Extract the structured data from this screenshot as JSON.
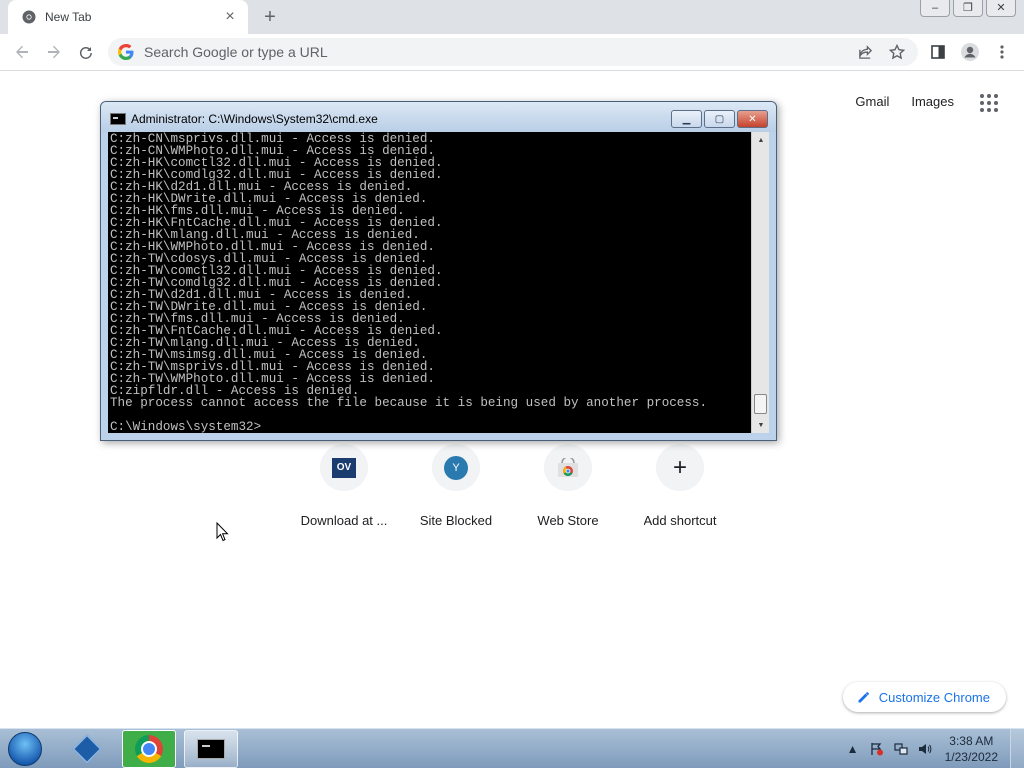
{
  "browser": {
    "tab": {
      "title": "New Tab"
    },
    "omnibox": {
      "placeholder": "Search Google or type a URL"
    }
  },
  "ntp": {
    "links": [
      {
        "label": "Gmail"
      },
      {
        "label": "Images"
      }
    ],
    "shortcuts": [
      {
        "label": "Download at ...",
        "icon": "ov-logo-icon",
        "icon_text": "OV"
      },
      {
        "label": "Site Blocked",
        "icon": "letter-y-icon",
        "icon_text": "Y"
      },
      {
        "label": "Web Store",
        "icon": "web-store-icon",
        "icon_text": ""
      },
      {
        "label": "Add shortcut",
        "icon": "plus-icon",
        "icon_text": "+"
      }
    ],
    "customize_label": "Customize Chrome"
  },
  "cmd": {
    "title": "Administrator: C:\\Windows\\System32\\cmd.exe",
    "lines": [
      "C:zh-CN\\msprivs.dll.mui - Access is denied.",
      "C:zh-CN\\WMPhoto.dll.mui - Access is denied.",
      "C:zh-HK\\comctl32.dll.mui - Access is denied.",
      "C:zh-HK\\comdlg32.dll.mui - Access is denied.",
      "C:zh-HK\\d2d1.dll.mui - Access is denied.",
      "C:zh-HK\\DWrite.dll.mui - Access is denied.",
      "C:zh-HK\\fms.dll.mui - Access is denied.",
      "C:zh-HK\\FntCache.dll.mui - Access is denied.",
      "C:zh-HK\\mlang.dll.mui - Access is denied.",
      "C:zh-HK\\WMPhoto.dll.mui - Access is denied.",
      "C:zh-TW\\cdosys.dll.mui - Access is denied.",
      "C:zh-TW\\comctl32.dll.mui - Access is denied.",
      "C:zh-TW\\comdlg32.dll.mui - Access is denied.",
      "C:zh-TW\\d2d1.dll.mui - Access is denied.",
      "C:zh-TW\\DWrite.dll.mui - Access is denied.",
      "C:zh-TW\\fms.dll.mui - Access is denied.",
      "C:zh-TW\\FntCache.dll.mui - Access is denied.",
      "C:zh-TW\\mlang.dll.mui - Access is denied.",
      "C:zh-TW\\msimsg.dll.mui - Access is denied.",
      "C:zh-TW\\msprivs.dll.mui - Access is denied.",
      "C:zh-TW\\WMPhoto.dll.mui - Access is denied.",
      "C:zipfldr.dll - Access is denied.",
      "The process cannot access the file because it is being used by another process.",
      "",
      "C:\\Windows\\system32>"
    ]
  },
  "taskbar": {
    "time": "3:38 AM",
    "date": "1/23/2022"
  },
  "colors": {
    "accent": "#1a73e8",
    "console_bg": "#000000",
    "console_text": "#c0c0c0",
    "taskbar": "#8fa9c6"
  }
}
